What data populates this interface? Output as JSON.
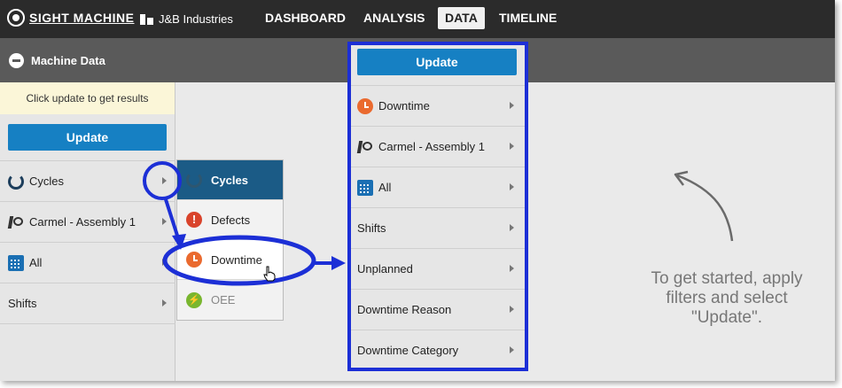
{
  "brand": {
    "name": "SIGHT MACHINE"
  },
  "company": "J&B Industries",
  "nav": [
    {
      "label": "DASHBOARD",
      "active": false
    },
    {
      "label": "ANALYSIS",
      "active": false
    },
    {
      "label": "DATA",
      "active": true
    },
    {
      "label": "TIMELINE",
      "active": false
    }
  ],
  "subheader": {
    "title": "Machine Data"
  },
  "left_panel": {
    "hint": "Click update to get results",
    "update_label": "Update",
    "filters": [
      {
        "icon": "cycle-icon",
        "label": "Cycles"
      },
      {
        "icon": "robot-arm-icon",
        "label": "Carmel - Assembly 1"
      },
      {
        "icon": "calendar-icon",
        "label": "All"
      },
      {
        "icon": "",
        "label": "Shifts"
      }
    ]
  },
  "flyout": {
    "items": [
      {
        "icon": "cycle-icon",
        "label": "Cycles",
        "state": "selected"
      },
      {
        "icon": "alert-icon",
        "label": "Defects",
        "state": "normal"
      },
      {
        "icon": "clock-icon",
        "label": "Downtime",
        "state": "hover"
      },
      {
        "icon": "bolt-icon",
        "label": "OEE",
        "state": "dim"
      }
    ]
  },
  "expanded_panel": {
    "update_label": "Update",
    "filters": [
      {
        "icon": "clock-icon",
        "label": "Downtime"
      },
      {
        "icon": "robot-arm-icon",
        "label": "Carmel - Assembly 1"
      },
      {
        "icon": "calendar-icon",
        "label": "All"
      },
      {
        "icon": "",
        "label": "Shifts"
      },
      {
        "icon": "",
        "label": "Unplanned"
      },
      {
        "icon": "",
        "label": "Downtime Reason"
      },
      {
        "icon": "",
        "label": "Downtime Category"
      }
    ]
  },
  "main": {
    "empty_message_lines": [
      "To get started, apply",
      "filters and select",
      "\"Update\"."
    ]
  },
  "colors": {
    "topbar": "#2b2b2b",
    "subbar": "#5a5a5a",
    "update_button": "#1680c3",
    "selected_item": "#1b5b86",
    "callout": "#1c2fd6",
    "hint_background": "#fbf6d8"
  }
}
